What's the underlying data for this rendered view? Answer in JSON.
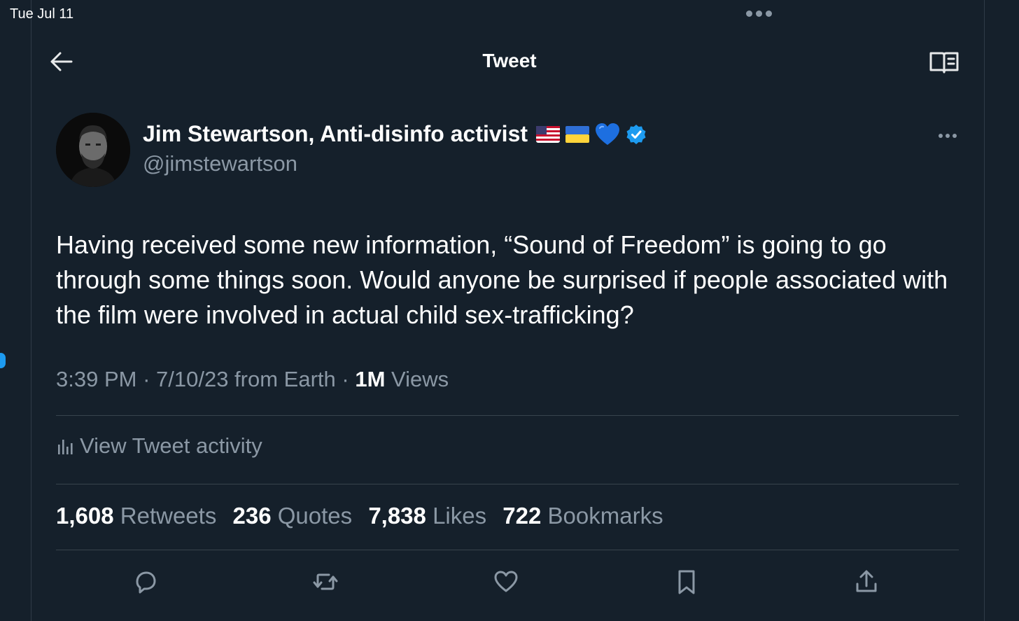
{
  "status_bar": {
    "date": "Tue Jul 11"
  },
  "header": {
    "title": "Tweet"
  },
  "author": {
    "name": "Jim Stewartson, Anti-disinfo activist",
    "name_emoji": [
      "us-flag",
      "ukraine-flag",
      "blue-heart"
    ],
    "verified": true,
    "handle": "@jimstewartson"
  },
  "tweet": {
    "text": "Having received some new information, “Sound of Freedom” is going to go through some things soon. Would anyone be surprised if people associated with the film were involved in actual child sex-trafficking?",
    "time": "3:39 PM",
    "sep1": " · ",
    "date_source": "7/10/23 from Earth",
    "sep2": " · ",
    "views_count": "1M",
    "views_label": " Views"
  },
  "activity": {
    "label": "View Tweet activity"
  },
  "stats": [
    {
      "count": "1,608",
      "label": "Retweets"
    },
    {
      "count": "236",
      "label": "Quotes"
    },
    {
      "count": "7,838",
      "label": "Likes"
    },
    {
      "count": "722",
      "label": "Bookmarks"
    }
  ],
  "actions": [
    "reply-icon",
    "retweet-icon",
    "like-icon",
    "bookmark-icon",
    "share-icon"
  ],
  "colors": {
    "background": "#15202b",
    "text_primary": "#ffffff",
    "text_secondary": "#8b98a5",
    "accent": "#1d9bf0",
    "divider": "#38444d"
  }
}
